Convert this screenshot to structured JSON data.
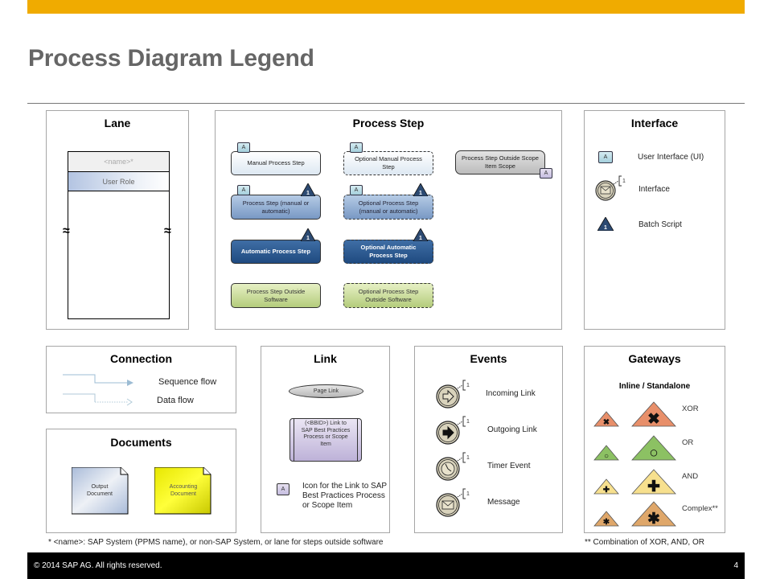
{
  "header": {
    "title": "Process Diagram Legend",
    "accent_color": "#f0ab00"
  },
  "lane": {
    "title": "Lane",
    "name_row": "<name>*",
    "role_row": "User Role",
    "break_symbol": "≈"
  },
  "process_step": {
    "title": "Process Step",
    "tag_letter": "A",
    "trigger_number": "1",
    "items": [
      {
        "label": "Manual Process Step"
      },
      {
        "label": "Optional Manual Process Step"
      },
      {
        "label": "Process Step Outside Scope Item Scope"
      },
      {
        "label": "Process Step (manual or automatic)"
      },
      {
        "label": "Optional Process Step (manual or automatic)"
      },
      {
        "label": "Automatic Process Step"
      },
      {
        "label": "Optional Automatic Process Step"
      },
      {
        "label": "Process Step Outside Software"
      },
      {
        "label": "Optional Process Step Outside Software"
      }
    ]
  },
  "interface": {
    "title": "Interface",
    "items": [
      {
        "icon": "user-interface-icon",
        "label": "User Interface (UI)",
        "tag": "A"
      },
      {
        "icon": "envelope-event-icon",
        "label": "Interface",
        "tag": "1"
      },
      {
        "icon": "batch-triangle-icon",
        "label": "Batch Script",
        "tag": "1"
      }
    ]
  },
  "connection": {
    "title": "Connection",
    "items": [
      {
        "label": "Sequence flow"
      },
      {
        "label": "Data flow"
      }
    ]
  },
  "documents": {
    "title": "Documents",
    "items": [
      {
        "label": "Output Document"
      },
      {
        "label": "Accounting Document"
      }
    ]
  },
  "link": {
    "title": "Link",
    "page_link": "Page Link",
    "bp_link": "(<BBID>) Link to SAP Best Practices Process or Scope Item",
    "icon_tag": "A",
    "icon_desc": "Icon for the Link to SAP Best Practices Process or Scope Item"
  },
  "events": {
    "title": "Events",
    "annotation": "1",
    "items": [
      {
        "icon": "incoming-link-icon",
        "label": "Incoming Link"
      },
      {
        "icon": "outgoing-link-icon",
        "label": "Outgoing Link"
      },
      {
        "icon": "timer-icon",
        "label": "Timer Event"
      },
      {
        "icon": "message-icon",
        "label": "Message"
      }
    ]
  },
  "gateways": {
    "title": "Gateways",
    "subtitle": "Inline / Standalone",
    "items": [
      {
        "label": "XOR",
        "symbol": "✖",
        "color": "#e88f6a"
      },
      {
        "label": "OR",
        "symbol": "○",
        "color": "#8cc163"
      },
      {
        "label": "AND",
        "symbol": "✚",
        "color": "#f7e08e"
      },
      {
        "label": "Complex**",
        "symbol": "✱",
        "color": "#dfa76a"
      }
    ]
  },
  "notes": {
    "left": "* <name>: SAP System (PPMS name), or non-SAP System, or lane for steps outside software",
    "right": "** Combination of XOR, AND, OR"
  },
  "footer": {
    "copyright": "© 2014 SAP AG. All rights reserved.",
    "page_number": "4"
  }
}
